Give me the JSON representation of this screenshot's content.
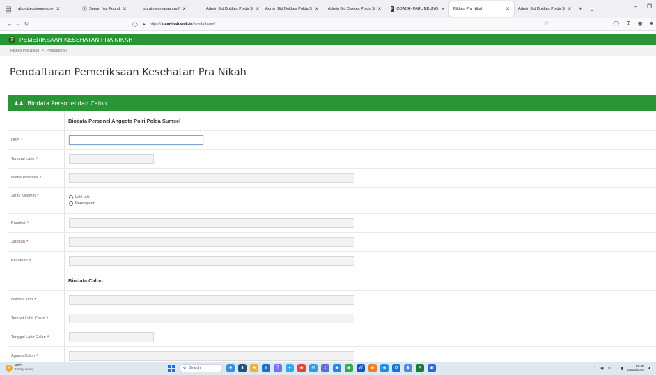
{
  "browser": {
    "tabs": [
      {
        "label": "aboutsessionrestore",
        "icon": "page-icon"
      },
      {
        "label": "Server Not Found",
        "icon": "warning-icon"
      },
      {
        "label": "surat-pernyataan.pdf",
        "icon": "pdf-icon"
      },
      {
        "label": "Admin Bid Dokkes Polda S",
        "icon": "page-icon"
      },
      {
        "label": "Admin Bid Dokkes Polda S",
        "icon": "page-icon"
      },
      {
        "label": "Admin Bid Dokkes Polda S",
        "icon": "page-icon"
      },
      {
        "label": "COACH- PARLINDUNG",
        "icon": "coach-icon"
      },
      {
        "label": "Rikkes Pra Nikah",
        "icon": "page-icon",
        "active": true
      },
      {
        "label": "Admin Bid Dokkes Polda S",
        "icon": "page-icon"
      }
    ],
    "url_prefix": "https://",
    "url_host": "siaonikah.web.id",
    "url_path": "/pendaftaran/"
  },
  "app": {
    "title": "PEMERIKSAAN KESEHATAN PRA NIKAH",
    "breadcrumb": [
      "Rikkes Pra Nikah",
      "Pendaftaran"
    ],
    "page_title": "Pendaftaran Pemeriksaan Kesehatan Pra Nikah"
  },
  "panel": {
    "title": "Biodata Personel dan Calon",
    "section1": "Biodata Personel Anggota Polri Polda Sumsel",
    "section2": "Biodata Calon",
    "fields": {
      "nrp": "NRP",
      "tanggal_lahir": "Tanggal Lahir",
      "nama_personel": "Nama Personel",
      "jenis_kelamin": "Jenis Kelamin",
      "pangkat": "Pangkat",
      "jabatan": "Jabatan",
      "kesatuan": "Kesatuan",
      "nama_calon": "Nama Calon",
      "tempat_lahir_calon": "Tempat Lahir Calon",
      "tanggal_lahir_calon": "Tanggal Lahir Calon",
      "agama_calon": "Agama Calon"
    },
    "gender_options": [
      "Laki-laki",
      "Perempuan"
    ],
    "required_mark": "*"
  },
  "taskbar": {
    "weather_temp": "29°F",
    "weather_desc": "Partly sunny",
    "search_label": "Search",
    "time": "08:30",
    "date": "04/06/2024"
  },
  "colors": {
    "brand_green": "#2a9534",
    "required_red": "#d9352b"
  }
}
